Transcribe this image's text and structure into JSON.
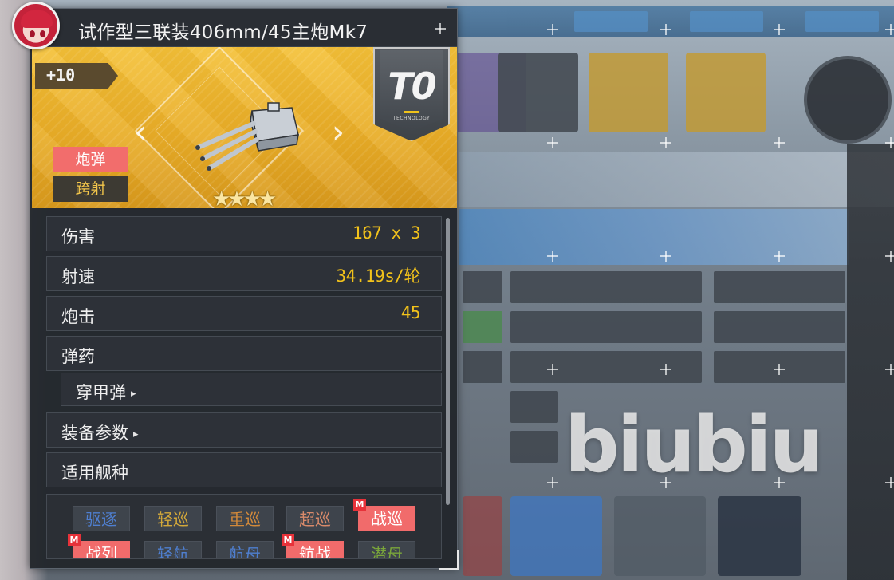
{
  "window": {
    "title": "试作型三联装406mm/45主炮Mk7"
  },
  "equipment": {
    "enhance_level": "+10",
    "tier_code": "T0",
    "tier_label": "TECHNOLOGY",
    "star_count": 4,
    "stars_text": "★★★★",
    "tags": [
      "炮弹",
      "跨射"
    ],
    "accent_color": "#f2c21b",
    "tag_color": "#f26d6c"
  },
  "stats": [
    {
      "label": "伤害",
      "value": "167 x 3"
    },
    {
      "label": "射速",
      "value": "34.19s/轮"
    },
    {
      "label": "炮击",
      "value": "45"
    },
    {
      "label": "弹药",
      "value": ""
    }
  ],
  "ammo": {
    "label": "穿甲弹",
    "arrow": "▸"
  },
  "params": {
    "label": "装备参数",
    "arrow": "▸"
  },
  "ship_types_section": {
    "label": "适用舰种"
  },
  "ship_types": [
    {
      "label": "驱逐",
      "enabled": false,
      "color": "#4f7fd0",
      "marker": ""
    },
    {
      "label": "轻巡",
      "enabled": false,
      "color": "#d4a93a",
      "marker": ""
    },
    {
      "label": "重巡",
      "enabled": false,
      "color": "#d48a3a",
      "marker": ""
    },
    {
      "label": "超巡",
      "enabled": false,
      "color": "#d98a6a",
      "marker": ""
    },
    {
      "label": "战巡",
      "enabled": true,
      "color": "#ffffff",
      "marker": "M"
    },
    {
      "label": "战列",
      "enabled": true,
      "color": "#ffffff",
      "marker": "M"
    },
    {
      "label": "轻航",
      "enabled": false,
      "color": "#4f7fd0",
      "marker": ""
    },
    {
      "label": "航母",
      "enabled": false,
      "color": "#4f7fd0",
      "marker": ""
    },
    {
      "label": "航战",
      "enabled": true,
      "color": "#ffffff",
      "marker": "M"
    },
    {
      "label": "潜母",
      "enabled": false,
      "color": "#7aa63a",
      "marker": ""
    }
  ],
  "watermark": "biubiu"
}
